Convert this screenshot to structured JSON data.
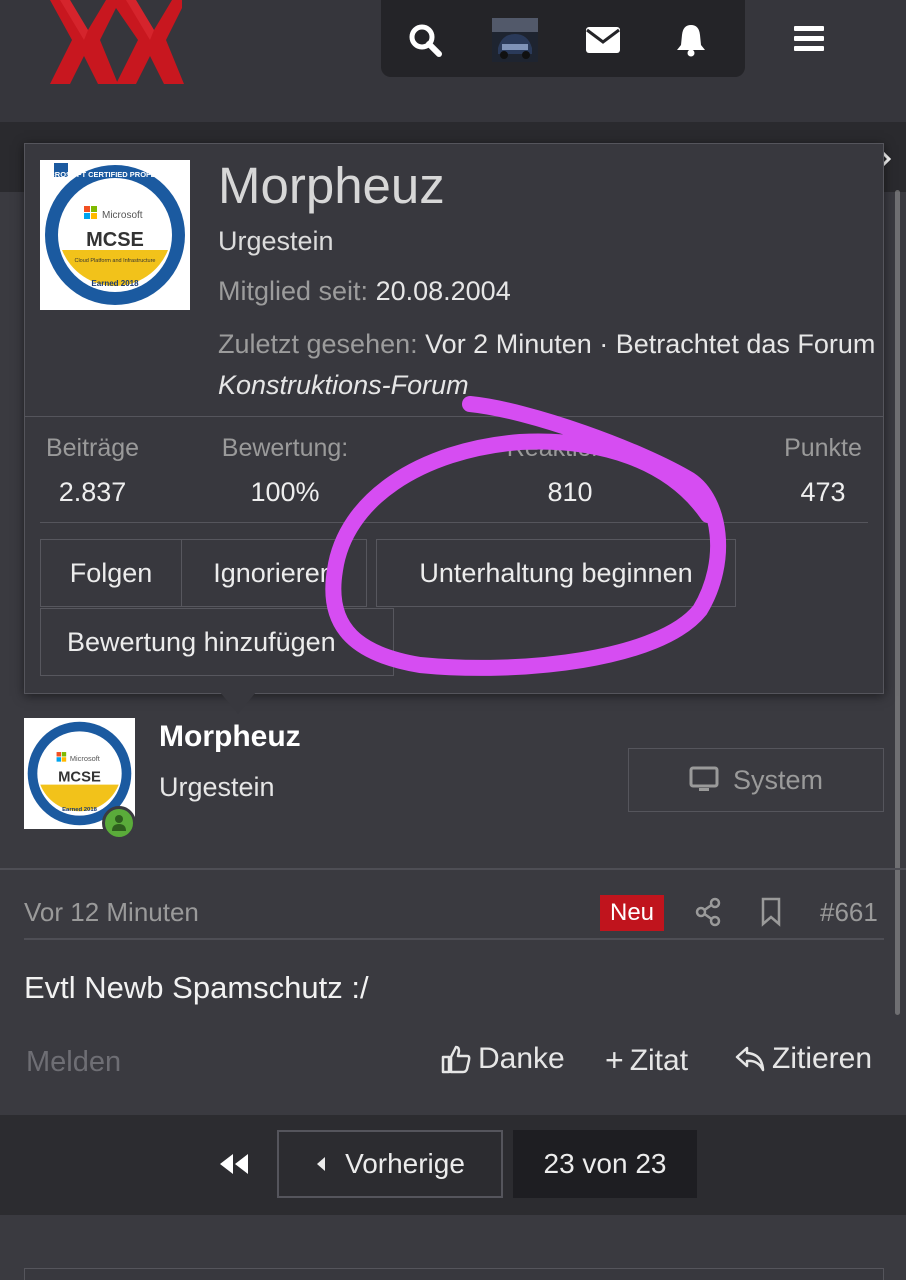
{
  "header": {
    "logo_text": "XX",
    "icons": [
      "search-icon",
      "profile-avatar",
      "envelope-icon",
      "bell-icon",
      "menu-icon"
    ]
  },
  "tooltip": {
    "name": "Morpheuz",
    "user_title": "Urgestein",
    "badge_lines": [
      "MICROSOFT CERTIFIED PROFESSIONAL",
      "Microsoft",
      "MCSE",
      "Cloud Platform and Infrastructure",
      "Earned 2018"
    ],
    "member_since_label": "Mitglied seit:",
    "member_since_value": "20.08.2004",
    "last_seen_label": "Zuletzt gesehen:",
    "last_seen_value": "Vor 2 Minuten",
    "activity_text": " · Betrachtet das Forum ",
    "activity_forum": "Konstruktions-Forum",
    "stats": [
      {
        "label": "Beiträge",
        "value": "2.837"
      },
      {
        "label": "Bewertung:",
        "value": "100%"
      },
      {
        "label": "Reaktionen",
        "value": "810"
      },
      {
        "label": "Punkte",
        "value": "473"
      }
    ],
    "buttons": {
      "follow": "Folgen",
      "ignore": "Ignorieren",
      "start_conversation": "Unterhaltung beginnen",
      "add_rating": "Bewertung hinzufügen"
    }
  },
  "post": {
    "author": "Morpheuz",
    "author_title": "Urgestein",
    "system_button": "System",
    "time": "Vor 12 Minuten",
    "badge_new": "Neu",
    "post_number": "#661",
    "body": "Evtl Newb Spamschutz :/",
    "report": "Melden",
    "actions": {
      "thanks": "Danke",
      "quote_add": "Zitat",
      "quote": "Zitieren"
    }
  },
  "pagination": {
    "previous": "Vorherige",
    "page_info": "23 von 23"
  },
  "colors": {
    "background": "#3a3a40",
    "logo_red": "#c8171f",
    "badge_red": "#c0141d",
    "annotation_magenta": "#d64df2",
    "online_green": "#5aab3a"
  }
}
